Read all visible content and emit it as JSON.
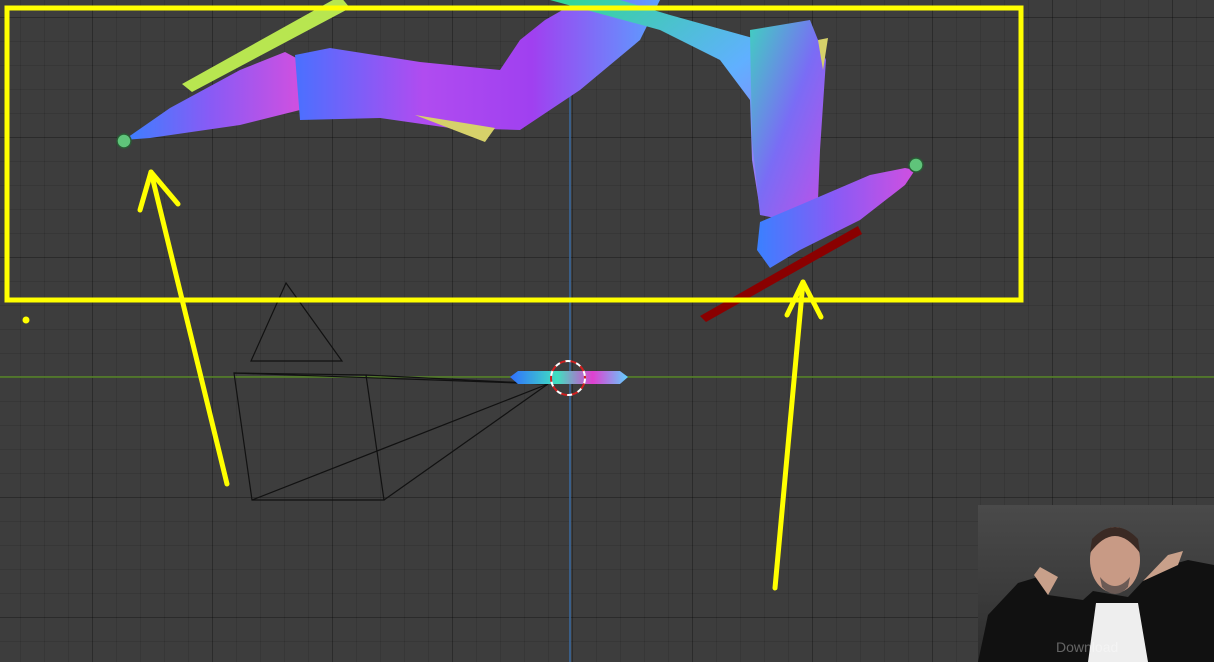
{
  "viewport": {
    "background": "#3d3d3d",
    "x_axis_color": "#5a8a2a",
    "z_axis_color": "#3a6aa0"
  },
  "annotations": {
    "highlight_color": "#ffff00",
    "arrow_color": "#ffff00"
  },
  "character": {
    "material": "normal-map-rainbow",
    "ik_target_color": "#5fc47a"
  },
  "webcam_overlay": {
    "watermark_text": "Download"
  }
}
